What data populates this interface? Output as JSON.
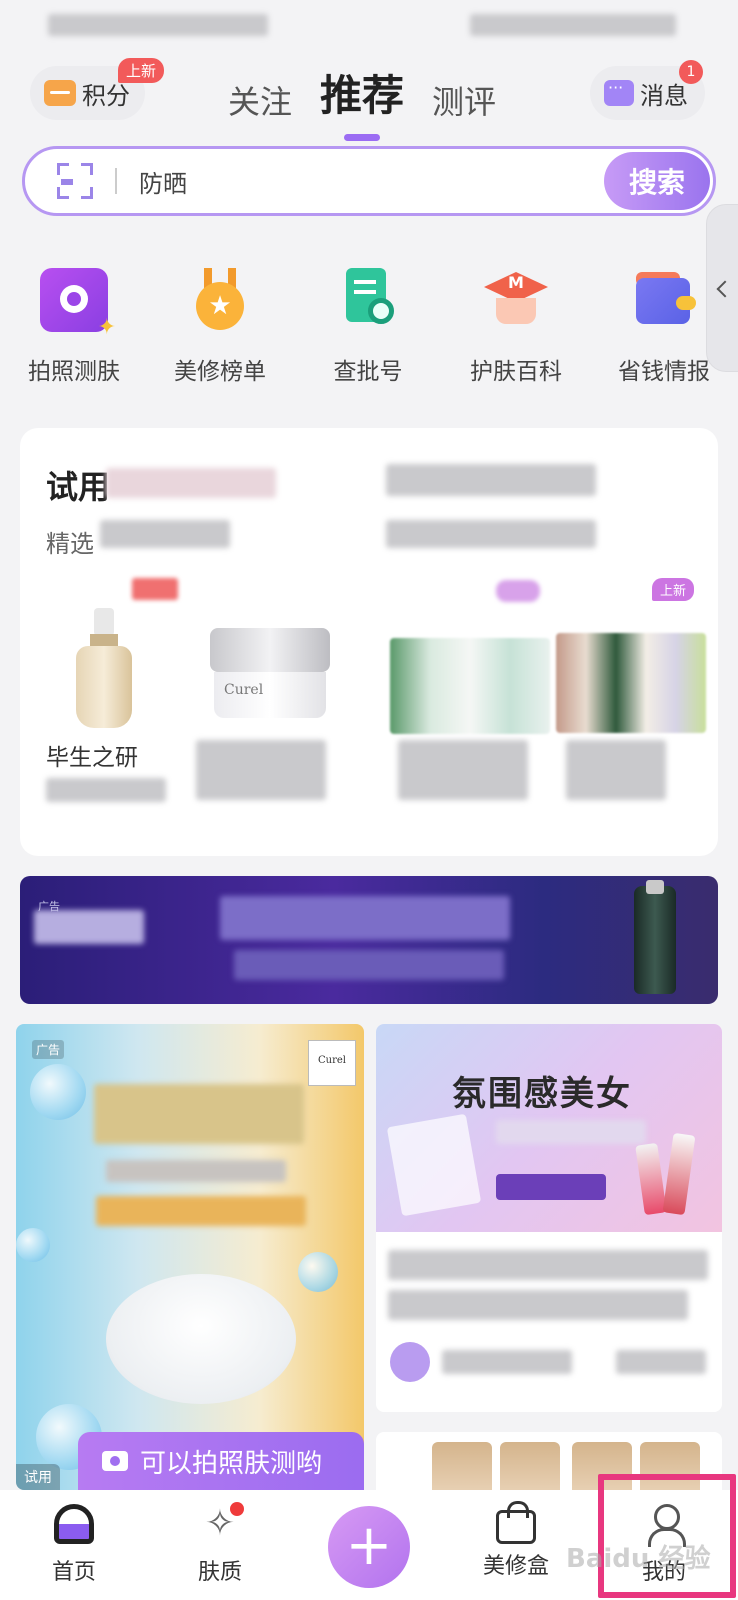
{
  "header": {
    "points_label": "积分",
    "points_badge": "上新",
    "tabs": [
      {
        "label": "关注",
        "active": false
      },
      {
        "label": "推荐",
        "active": true
      },
      {
        "label": "测评",
        "active": false
      }
    ],
    "messages_label": "消息",
    "messages_count": "1"
  },
  "search": {
    "query": "防晒",
    "button_label": "搜索"
  },
  "quick_functions": [
    {
      "label": "拍照测肤",
      "icon": "camera-icon"
    },
    {
      "label": "美修榜单",
      "icon": "medal-icon"
    },
    {
      "label": "查批号",
      "icon": "batch-search-icon"
    },
    {
      "label": "护肤百科",
      "icon": "graduation-cap-icon"
    },
    {
      "label": "省钱情报",
      "icon": "wallet-icon"
    }
  ],
  "trial_section": {
    "title": "试用",
    "subtitle": "精选",
    "new_tag": "上新",
    "item_name": "毕生之研"
  },
  "ad_banner": {
    "tag": "广告"
  },
  "feed": {
    "left_card": {
      "ad_tag": "广告",
      "brand": "Curel",
      "trial_tag": "试用",
      "photo_hint": "可以拍照肤测哟"
    },
    "right_card": {
      "title": "氛围感美女"
    }
  },
  "bottom_nav": [
    {
      "label": "首页",
      "icon": "home-icon",
      "active": true
    },
    {
      "label": "肤质",
      "icon": "skin-icon",
      "active": false
    },
    {
      "label": "美修盒",
      "icon": "bag-icon",
      "active": false
    },
    {
      "label": "我的",
      "icon": "profile-icon",
      "active": false
    }
  ],
  "colors": {
    "accent": "#9b6cf3",
    "badge": "#f25a5a",
    "highlight": "#e8377f"
  },
  "watermark": "Baidu 经验"
}
